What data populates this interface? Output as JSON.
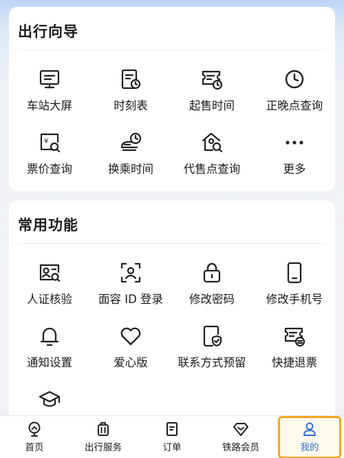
{
  "guide": {
    "title": "出行向导",
    "items": [
      {
        "label": "车站大屏",
        "icon": "station-screen-icon"
      },
      {
        "label": "时刻表",
        "icon": "timetable-icon"
      },
      {
        "label": "起售时间",
        "icon": "sale-time-icon"
      },
      {
        "label": "正晚点查询",
        "icon": "clock-icon"
      },
      {
        "label": "票价查询",
        "icon": "fare-search-icon"
      },
      {
        "label": "换乘时间",
        "icon": "transfer-time-icon"
      },
      {
        "label": "代售点查询",
        "icon": "agency-search-icon"
      },
      {
        "label": "更多",
        "icon": "more-icon"
      }
    ]
  },
  "common": {
    "title": "常用功能",
    "items": [
      {
        "label": "人证核验",
        "icon": "id-verify-icon"
      },
      {
        "label": "面容 ID 登录",
        "icon": "face-id-icon"
      },
      {
        "label": "修改密码",
        "icon": "lock-icon"
      },
      {
        "label": "修改手机号",
        "icon": "phone-icon"
      },
      {
        "label": "通知设置",
        "icon": "bell-icon"
      },
      {
        "label": "爱心版",
        "icon": "heart-icon"
      },
      {
        "label": "联系方式预留",
        "icon": "contact-shield-icon"
      },
      {
        "label": "快捷退票",
        "icon": "refund-ticket-icon"
      },
      {
        "label": "",
        "icon": "graduation-cap-icon"
      }
    ]
  },
  "tabbar": {
    "tabs": [
      {
        "label": "首页",
        "icon": "home-icon"
      },
      {
        "label": "出行服务",
        "icon": "luggage-icon"
      },
      {
        "label": "订单",
        "icon": "order-icon"
      },
      {
        "label": "铁路会员",
        "icon": "diamond-icon"
      },
      {
        "label": "我的",
        "icon": "person-icon",
        "active": true
      }
    ]
  },
  "colors": {
    "accent": "#2f6fd8",
    "highlight": "#f5a623"
  }
}
